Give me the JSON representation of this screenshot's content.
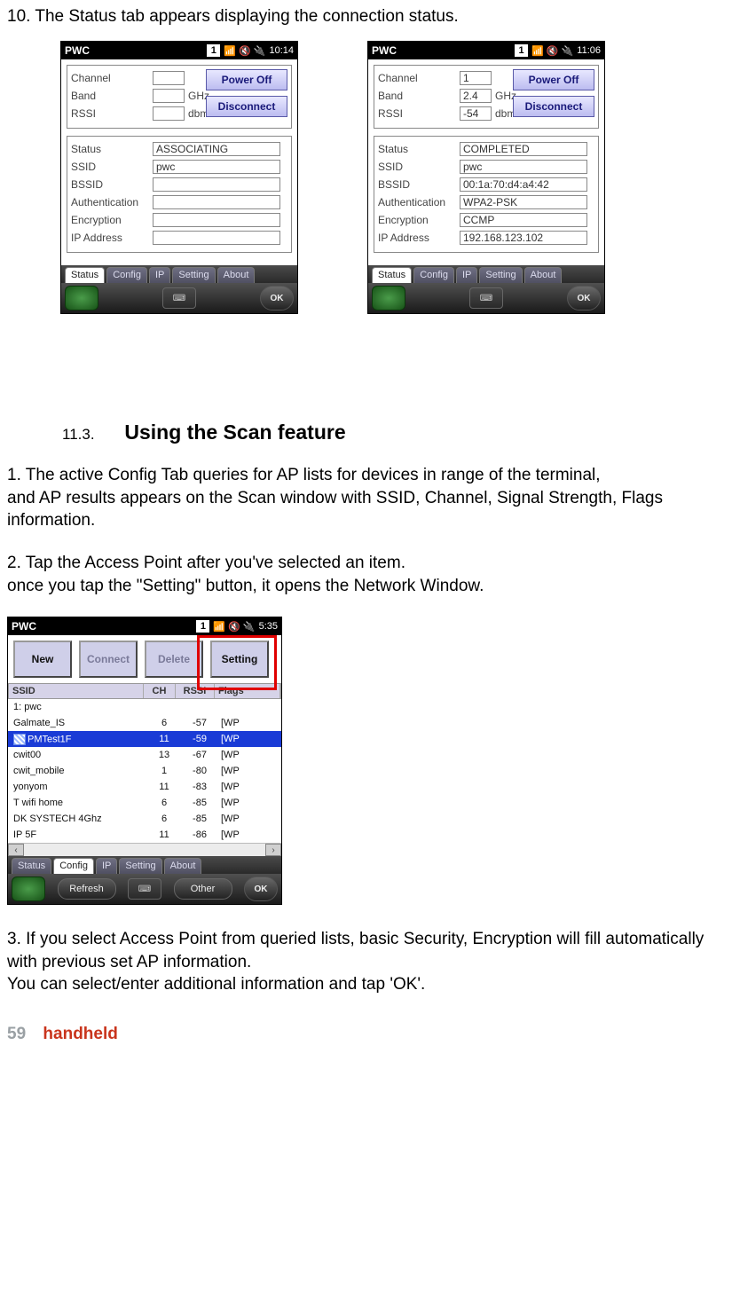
{
  "intro_step": "10. The Status tab appears displaying the connection status.",
  "screens": {
    "left": {
      "title": "PWC",
      "clock": "10:14",
      "notif": "1",
      "rows1": [
        {
          "label": "Channel",
          "value": "",
          "unit": ""
        },
        {
          "label": "Band",
          "value": "",
          "unit": "GHz"
        },
        {
          "label": "RSSI",
          "value": "",
          "unit": "dbm"
        }
      ],
      "buttons": {
        "power": "Power Off",
        "disc": "Disconnect"
      },
      "rows2": [
        {
          "label": "Status",
          "value": "ASSOCIATING"
        },
        {
          "label": "SSID",
          "value": "pwc"
        },
        {
          "label": "BSSID",
          "value": ""
        },
        {
          "label": "Authentication",
          "value": ""
        },
        {
          "label": "Encryption",
          "value": ""
        },
        {
          "label": "IP Address",
          "value": ""
        }
      ],
      "tabs": [
        "Status",
        "Config",
        "IP",
        "Setting",
        "About"
      ],
      "active_tab": "Status",
      "ok": "OK"
    },
    "right": {
      "title": "PWC",
      "clock": "11:06",
      "notif": "1",
      "rows1": [
        {
          "label": "Channel",
          "value": "1",
          "unit": ""
        },
        {
          "label": "Band",
          "value": "2.4",
          "unit": "GHz"
        },
        {
          "label": "RSSI",
          "value": "-54",
          "unit": "dbm"
        }
      ],
      "buttons": {
        "power": "Power Off",
        "disc": "Disconnect"
      },
      "rows2": [
        {
          "label": "Status",
          "value": "COMPLETED"
        },
        {
          "label": "SSID",
          "value": "pwc"
        },
        {
          "label": "BSSID",
          "value": "00:1a:70:d4:a4:42"
        },
        {
          "label": "Authentication",
          "value": "WPA2-PSK"
        },
        {
          "label": "Encryption",
          "value": "CCMP"
        },
        {
          "label": "IP Address",
          "value": "192.168.123.102"
        }
      ],
      "tabs": [
        "Status",
        "Config",
        "IP",
        "Setting",
        "About"
      ],
      "active_tab": "Status",
      "ok": "OK"
    }
  },
  "section": {
    "num": "11.3.",
    "title": "Using the Scan feature"
  },
  "para1a": "1. The active Config Tab queries for AP lists for devices in range of the terminal,",
  "para1b": "and AP results appears on the Scan window with SSID, Channel, Signal Strength, Flags information.",
  "para2a": "2. Tap the Access Point after you've selected an item.",
  "para2b": "once you tap the \"Setting\" button, it opens the Network Window.",
  "scan": {
    "title": "PWC",
    "clock": "5:35",
    "notif": "1",
    "toolbar": {
      "new": "New",
      "connect": "Connect",
      "delete": "Delete",
      "setting": "Setting"
    },
    "headers": {
      "ssid": "SSID",
      "ch": "CH",
      "rssi": "RSSI",
      "flags": "Flags"
    },
    "rows": [
      {
        "ssid": "1: pwc",
        "ch": "",
        "rssi": "",
        "flags": "",
        "sel": false
      },
      {
        "ssid": "Galmate_IS",
        "ch": "6",
        "rssi": "-57",
        "flags": "[WP",
        "sel": false
      },
      {
        "ssid": "PMTest1F",
        "ch": "11",
        "rssi": "-59",
        "flags": "[WP",
        "sel": true,
        "icon": true
      },
      {
        "ssid": "cwit00",
        "ch": "13",
        "rssi": "-67",
        "flags": "[WP",
        "sel": false
      },
      {
        "ssid": "cwit_mobile",
        "ch": "1",
        "rssi": "-80",
        "flags": "[WP",
        "sel": false
      },
      {
        "ssid": "yonyom",
        "ch": "11",
        "rssi": "-83",
        "flags": "[WP",
        "sel": false
      },
      {
        "ssid": "T wifi home",
        "ch": "6",
        "rssi": "-85",
        "flags": "[WP",
        "sel": false
      },
      {
        "ssid": "DK SYSTECH 4Ghz",
        "ch": "6",
        "rssi": "-85",
        "flags": "[WP",
        "sel": false
      },
      {
        "ssid": "IP 5F",
        "ch": "11",
        "rssi": "-86",
        "flags": "[WP",
        "sel": false
      }
    ],
    "tabs": [
      "Status",
      "Config",
      "IP",
      "Setting",
      "About"
    ],
    "active_tab": "Config",
    "soft": {
      "refresh": "Refresh",
      "other": "Other",
      "ok": "OK"
    }
  },
  "para3a": "3. If you select Access Point from queried lists, basic Security, Encryption will fill automatically with previous set AP information.",
  "para3b": "You can select/enter additional information and tap 'OK'.",
  "footer": {
    "page": "59",
    "brand": "handheld"
  }
}
